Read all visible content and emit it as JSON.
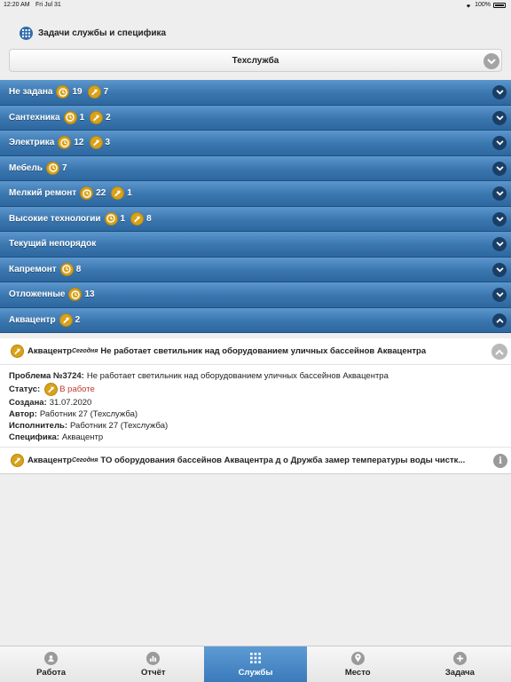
{
  "status_bar": {
    "time": "12:20 AM",
    "date": "Fri Jul 31",
    "battery": "100%"
  },
  "header": {
    "title": "Задачи службы и специфика",
    "icon": "grid-icon"
  },
  "service_select": {
    "value": "Техслужба"
  },
  "categories": [
    {
      "label": "Не задана",
      "badges": [
        {
          "icon": "clock",
          "count": "19"
        },
        {
          "icon": "hammer",
          "count": "7"
        }
      ],
      "expanded": false
    },
    {
      "label": "Сантехника",
      "badges": [
        {
          "icon": "clock",
          "count": "1"
        },
        {
          "icon": "hammer",
          "count": "2"
        }
      ],
      "expanded": false
    },
    {
      "label": "Электрика",
      "badges": [
        {
          "icon": "clock",
          "count": "12"
        },
        {
          "icon": "hammer",
          "count": "3"
        }
      ],
      "expanded": false
    },
    {
      "label": "Мебель",
      "badges": [
        {
          "icon": "clock",
          "count": "7"
        }
      ],
      "expanded": false
    },
    {
      "label": "Мелкий ремонт",
      "badges": [
        {
          "icon": "clock",
          "count": "22"
        },
        {
          "icon": "hammer",
          "count": "1"
        }
      ],
      "expanded": false
    },
    {
      "label": "Высокие технологии",
      "badges": [
        {
          "icon": "clock",
          "count": "1"
        },
        {
          "icon": "hammer",
          "count": "8"
        }
      ],
      "expanded": false
    },
    {
      "label": "Текущий непорядок",
      "badges": [],
      "expanded": false
    },
    {
      "label": "Капремонт",
      "badges": [
        {
          "icon": "clock",
          "count": "8"
        }
      ],
      "expanded": false
    },
    {
      "label": "Отложенные",
      "badges": [
        {
          "icon": "clock",
          "count": "13"
        }
      ],
      "expanded": false
    },
    {
      "label": "Аквацентр",
      "badges": [
        {
          "icon": "hammer",
          "count": "2"
        }
      ],
      "expanded": true
    }
  ],
  "tasks": [
    {
      "place": "Аквацентр",
      "when": "Сегодня",
      "title": "Не работает светильник над оборудованием уличных бассейнов Аквацентра",
      "problem_label": "Проблема №3724:",
      "problem_text": "Не работает светильник над оборудованием уличных бассейнов Аквацентра",
      "status_label": "Статус:",
      "status_value": "В работе",
      "created_label": "Создана:",
      "created_value": "31.07.2020",
      "author_label": "Автор:",
      "author_value": "Работник 27 (Техслужба)",
      "executor_label": "Исполнитель:",
      "executor_value": "Работник 27 (Техслужба)",
      "spec_label": "Специфика:",
      "spec_value": "Аквацентр"
    },
    {
      "place": "Аквацентр",
      "when": "Сегодня",
      "title": "ТО оборудования бассейнов Аквацентра д о Дружба замер температуры воды чистк..."
    }
  ],
  "tabs": [
    {
      "label": "Работа",
      "icon": "person-icon",
      "active": false
    },
    {
      "label": "Отчёт",
      "icon": "chart-icon",
      "active": false
    },
    {
      "label": "Службы",
      "icon": "grid-icon",
      "active": true
    },
    {
      "label": "Место",
      "icon": "pin-icon",
      "active": false
    },
    {
      "label": "Задача",
      "icon": "plus-icon",
      "active": false
    }
  ],
  "colors": {
    "accent": "#3a76ae",
    "badge": "#d8a21a",
    "status": "#c0392b"
  }
}
